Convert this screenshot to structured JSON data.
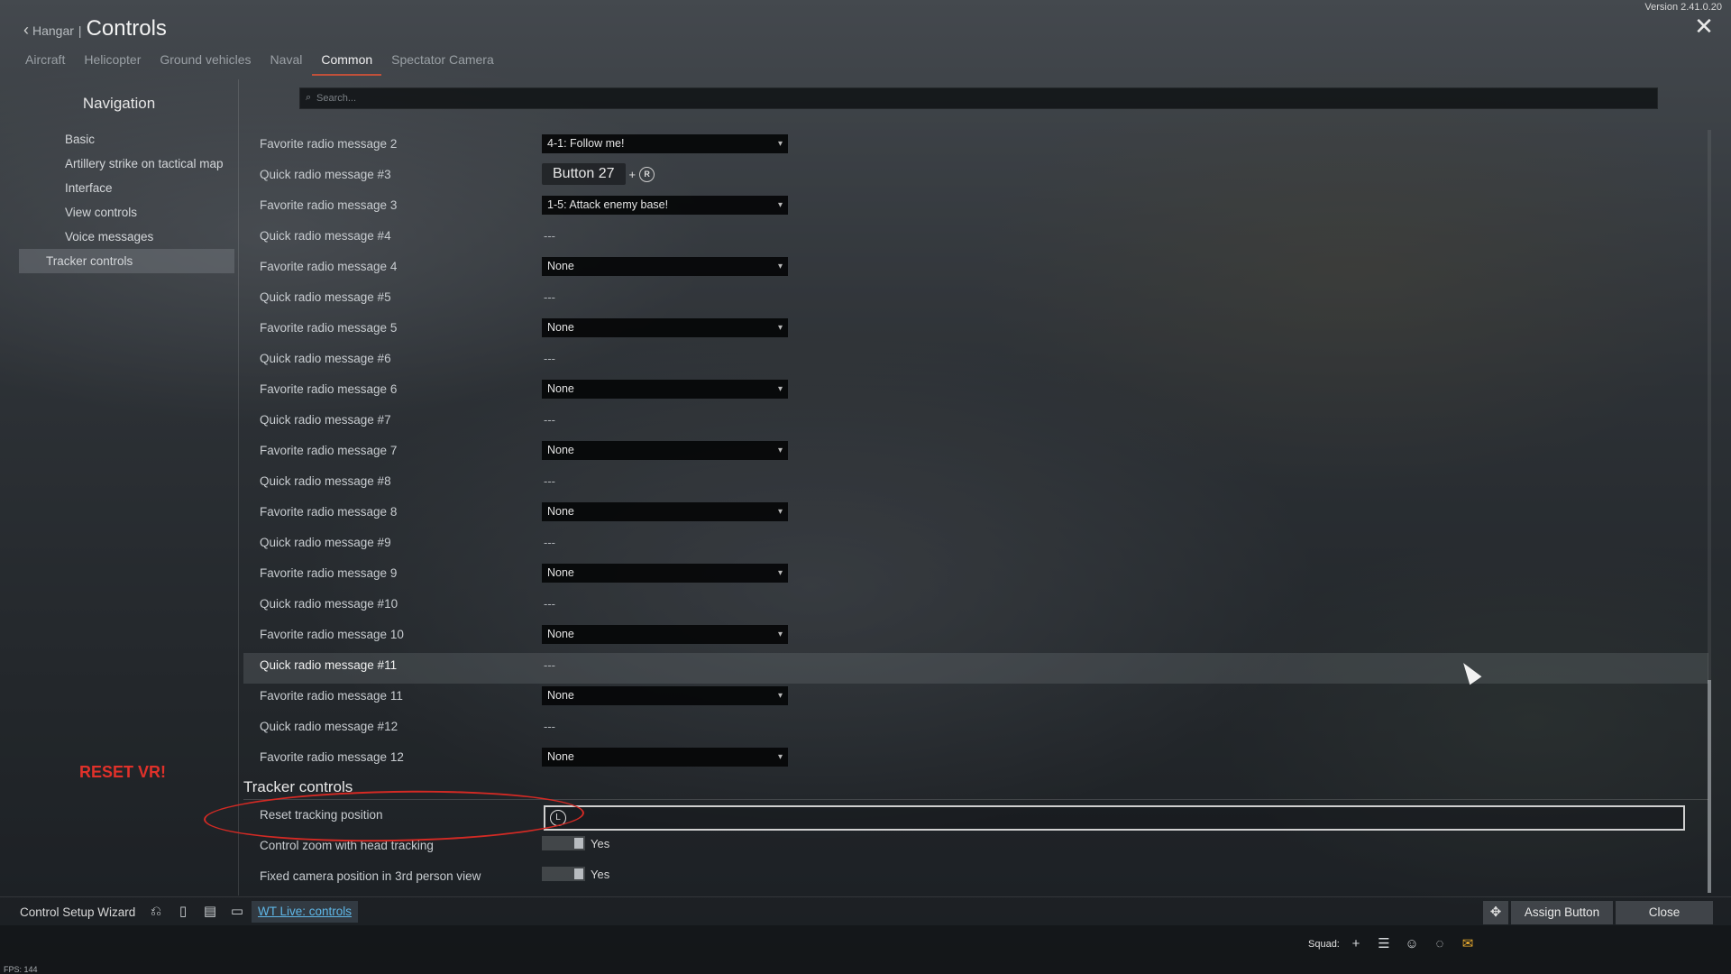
{
  "version": "Version 2.41.0.20",
  "header": {
    "back_label": "Hangar",
    "separator": "|",
    "title": "Controls"
  },
  "tabs": [
    {
      "label": "Aircraft",
      "active": false
    },
    {
      "label": "Helicopter",
      "active": false
    },
    {
      "label": "Ground vehicles",
      "active": false
    },
    {
      "label": "Naval",
      "active": false
    },
    {
      "label": "Common",
      "active": true
    },
    {
      "label": "Spectator Camera",
      "active": false
    }
  ],
  "nav": {
    "title": "Navigation",
    "items": [
      {
        "label": "Basic"
      },
      {
        "label": "Artillery strike on tactical map"
      },
      {
        "label": "Interface"
      },
      {
        "label": "View controls"
      },
      {
        "label": "Voice messages"
      },
      {
        "label": "Tracker controls",
        "active": true
      }
    ]
  },
  "search": {
    "placeholder": "Search..."
  },
  "rows": [
    {
      "label": "Favorite radio message 2",
      "type": "dropdown",
      "value": "4-1: Follow me!"
    },
    {
      "label": "Quick radio message #3",
      "type": "binding",
      "button": "Button 27",
      "plus": "+",
      "pad": "R"
    },
    {
      "label": "Favorite radio message 3",
      "type": "dropdown",
      "value": "1-5: Attack enemy base!"
    },
    {
      "label": "Quick radio message #4",
      "type": "empty",
      "value": "---"
    },
    {
      "label": "Favorite radio message 4",
      "type": "dropdown",
      "value": "None"
    },
    {
      "label": "Quick radio message #5",
      "type": "empty",
      "value": "---"
    },
    {
      "label": "Favorite radio message 5",
      "type": "dropdown",
      "value": "None"
    },
    {
      "label": "Quick radio message #6",
      "type": "empty",
      "value": "---"
    },
    {
      "label": "Favorite radio message 6",
      "type": "dropdown",
      "value": "None"
    },
    {
      "label": "Quick radio message #7",
      "type": "empty",
      "value": "---"
    },
    {
      "label": "Favorite radio message 7",
      "type": "dropdown",
      "value": "None"
    },
    {
      "label": "Quick radio message #8",
      "type": "empty",
      "value": "---"
    },
    {
      "label": "Favorite radio message 8",
      "type": "dropdown",
      "value": "None"
    },
    {
      "label": "Quick radio message #9",
      "type": "empty",
      "value": "---"
    },
    {
      "label": "Favorite radio message 9",
      "type": "dropdown",
      "value": "None"
    },
    {
      "label": "Quick radio message #10",
      "type": "empty",
      "value": "---"
    },
    {
      "label": "Favorite radio message 10",
      "type": "dropdown",
      "value": "None"
    },
    {
      "label": "Quick radio message #11",
      "type": "empty",
      "value": "---",
      "highlighted": true
    },
    {
      "label": "Favorite radio message 11",
      "type": "dropdown",
      "value": "None"
    },
    {
      "label": "Quick radio message #12",
      "type": "empty",
      "value": "---"
    },
    {
      "label": "Favorite radio message 12",
      "type": "dropdown",
      "value": "None"
    }
  ],
  "annotation": {
    "text": "RESET VR!",
    "color": "#e0312a"
  },
  "tracker": {
    "section_title": "Tracker controls",
    "rows": [
      {
        "label": "Reset tracking position",
        "type": "bindbox",
        "icon": "clock-icon"
      },
      {
        "label": "Control zoom with head tracking",
        "type": "toggle",
        "value": "Yes"
      },
      {
        "label": "Fixed camera position in 3rd person view",
        "type": "toggle",
        "value": "Yes"
      }
    ]
  },
  "bottom": {
    "wizard_label": "Control Setup Wizard",
    "icons": [
      "reset-icon",
      "new-file-icon",
      "save-icon",
      "open-folder-icon"
    ],
    "wt_live": "WT Live: controls",
    "assign_button": "Assign Button",
    "close_button": "Close"
  },
  "squad": {
    "label": "Squad:",
    "icons": [
      "add-icon",
      "list-icon",
      "friends-icon",
      "chat-icon",
      "mail-icon"
    ]
  },
  "fps": "FPS: 144",
  "colors": {
    "accent": "#c0503a",
    "link": "#5fb6e6",
    "mail": "#f0b030",
    "annotation": "#d42a24"
  }
}
